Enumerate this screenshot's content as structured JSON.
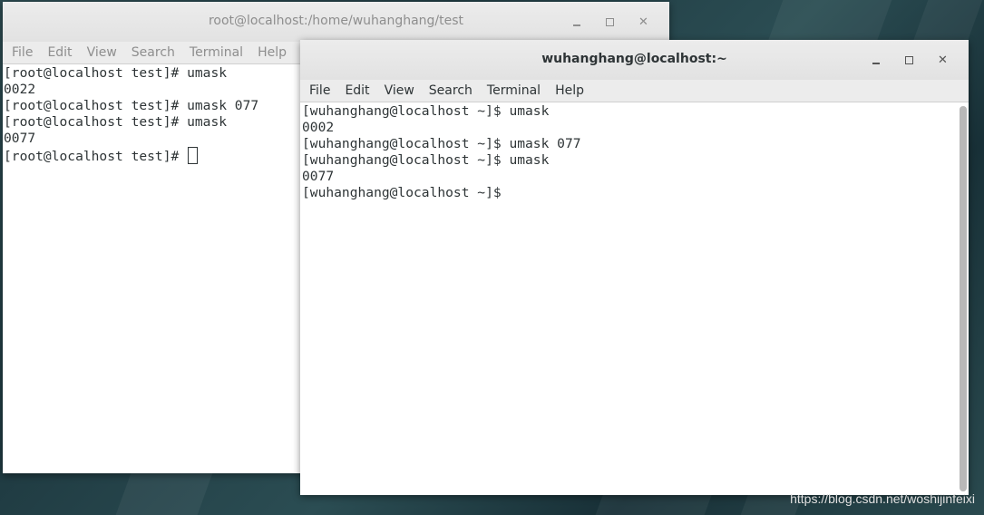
{
  "window_back": {
    "title": "root@localhost:/home/wuhanghang/test",
    "menu": [
      "File",
      "Edit",
      "View",
      "Search",
      "Terminal",
      "Help"
    ],
    "lines": [
      "[root@localhost test]# umask",
      "0022",
      "[root@localhost test]# umask 077",
      "[root@localhost test]# umask",
      "0077",
      "[root@localhost test]# "
    ]
  },
  "window_front": {
    "title": "wuhanghang@localhost:~",
    "menu": [
      "File",
      "Edit",
      "View",
      "Search",
      "Terminal",
      "Help"
    ],
    "lines": [
      "[wuhanghang@localhost ~]$ umask",
      "0002",
      "[wuhanghang@localhost ~]$ umask 077",
      "[wuhanghang@localhost ~]$ umask",
      "0077",
      "[wuhanghang@localhost ~]$ "
    ]
  },
  "window_buttons": {
    "minimize": "minimize-icon",
    "maximize": "maximize-icon",
    "close": "✕"
  },
  "watermark": "https://blog.csdn.net/woshijinfeixi",
  "colors": {
    "titlebar": "#e2e2e2",
    "terminal_bg": "#ffffff",
    "text": "#2e3436",
    "desktop": "#2b4a50"
  }
}
